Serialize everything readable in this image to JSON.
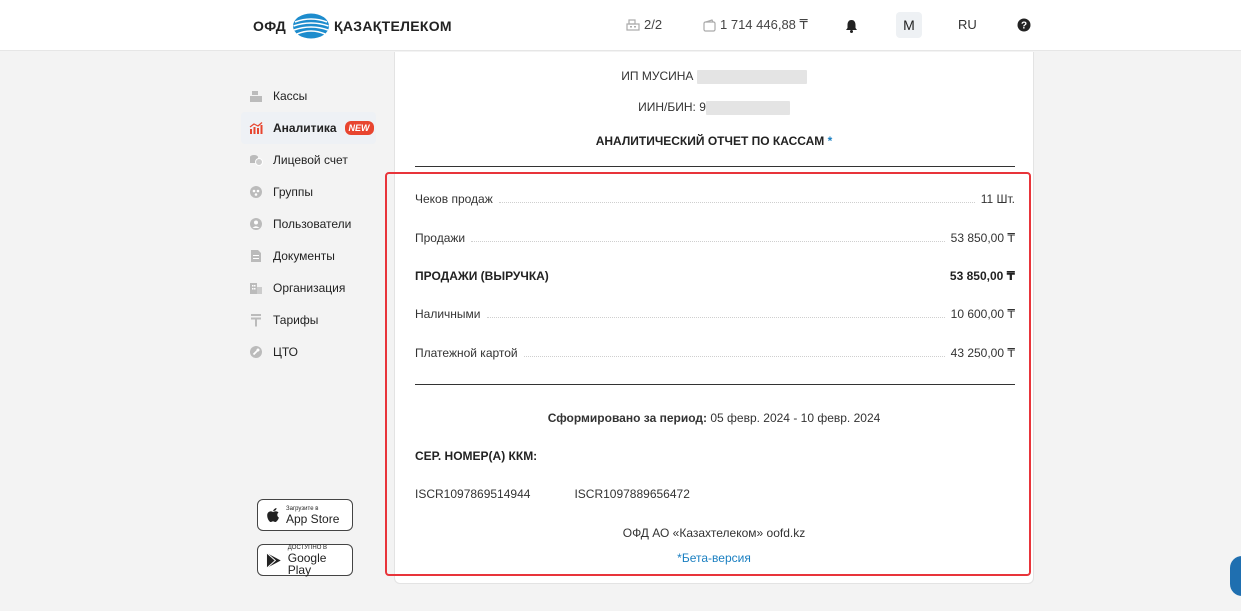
{
  "header": {
    "logo_ofd": "ОФД",
    "logo_company": "ҚАЗАҚТЕЛЕКОМ",
    "registers_count": "2/2",
    "balance": "1 714 446,88 ₸",
    "user_initial": "M",
    "language": "RU",
    "icons": [
      "cash-register-icon",
      "wallet-icon",
      "bell-icon",
      "help-icon"
    ]
  },
  "sidebar": {
    "items": [
      {
        "label": "Кассы",
        "icon": "cash-register-icon"
      },
      {
        "label": "Аналитика",
        "icon": "analytics-icon",
        "badge": "NEW",
        "active": true
      },
      {
        "label": "Лицевой счет",
        "icon": "coins-icon"
      },
      {
        "label": "Группы",
        "icon": "group-icon"
      },
      {
        "label": "Пользователи",
        "icon": "user-icon"
      },
      {
        "label": "Документы",
        "icon": "document-icon"
      },
      {
        "label": "Организация",
        "icon": "building-icon"
      },
      {
        "label": "Тарифы",
        "icon": "tenge-icon"
      },
      {
        "label": "ЦТО",
        "icon": "wrench-icon"
      }
    ],
    "app_store": {
      "small": "Загрузите в",
      "big": "App Store"
    },
    "google_play": {
      "small": "ДОСТУПНО В",
      "big": "Google Play"
    }
  },
  "report": {
    "company_prefix": "ИП МУСИНА",
    "iin_prefix": "ИИН/БИН: 9",
    "title": "АНАЛИТИЧЕСКИЙ ОТЧЕТ ПО КАССАМ",
    "title_mark": "*",
    "rows": [
      {
        "label": "Чеков продаж",
        "value": "11 Шт.",
        "bold": false
      },
      {
        "label": "Продажи",
        "value": "53 850,00 ₸",
        "bold": false
      },
      {
        "label": "ПРОДАЖИ (ВЫРУЧКА)",
        "value": "53 850,00 ₸",
        "bold": true
      },
      {
        "label": "Наличными",
        "value": "10 600,00 ₸",
        "bold": false
      },
      {
        "label": "Платежной картой",
        "value": "43 250,00 ₸",
        "bold": false
      }
    ],
    "period_label": "Сформировано за период:",
    "period_value": "05 февр. 2024 - 10 февр. 2024",
    "serials_label": "СЕР. НОМЕР(А) ККМ:",
    "serials": [
      "ISCR1097869514944",
      "ISCR1097889656472"
    ],
    "footer": "ОФД АО «Казахтелеком» oofd.kz",
    "beta": "*Бета-версия"
  },
  "colors": {
    "accent": "#1a7fc1",
    "badge": "#e8452f",
    "highlight_box": "#e8343a"
  }
}
